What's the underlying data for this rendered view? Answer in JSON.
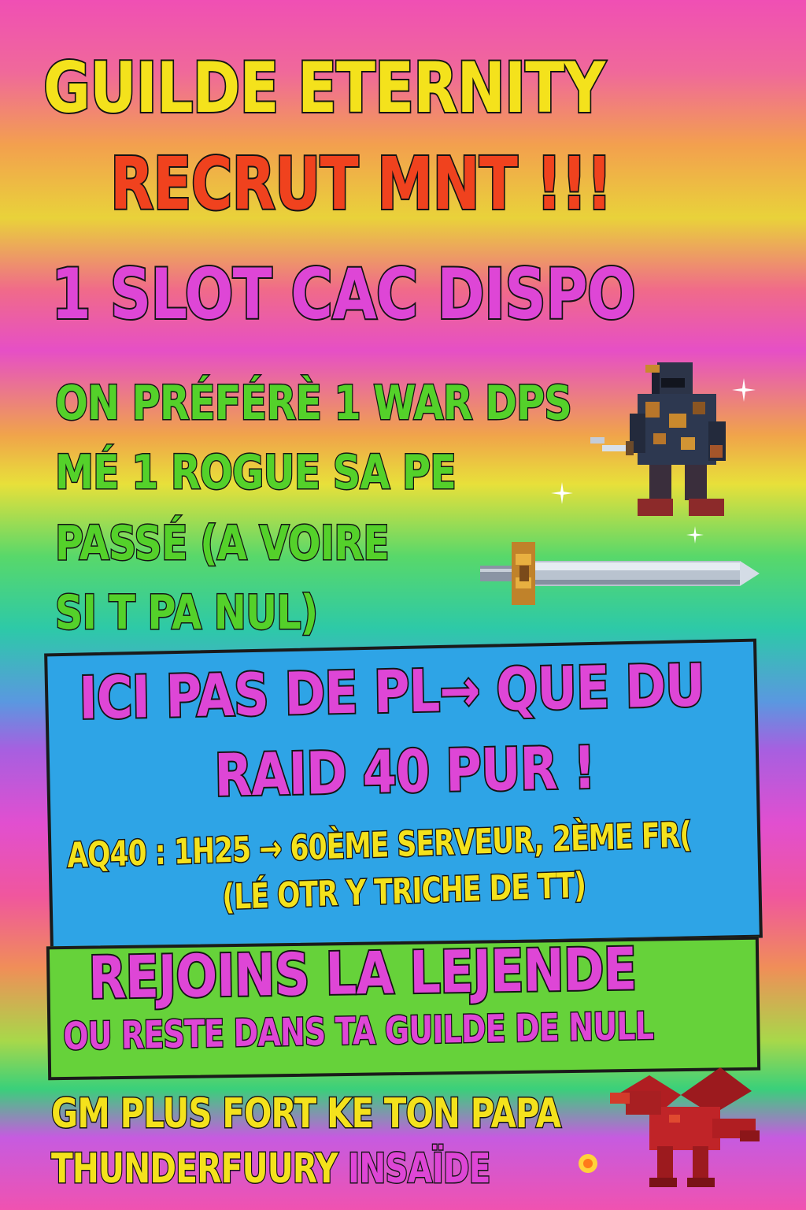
{
  "header": {
    "title": "GUILDE ETERNITY",
    "subtitle": "RECRUT MNT !!!",
    "slot": "1 SLOT CAC DISPO"
  },
  "preference": {
    "lines": [
      "ON PRÉFÉRÈ 1 WAR DPS",
      "MÉ 1 ROGUE SA PE",
      "PASSÉ (A VOIRE",
      "SI T PA NUL)"
    ]
  },
  "raid_box": {
    "line1": "ICI PAS DE PL→ QUE DU",
    "line2": "RAID 40 PUR !",
    "line3": "AQ40 : 1H25 → 60ÈME SERVEUR, 2ÈME FR(",
    "line4": "(LÉ OTR Y TRICHE DE TT)",
    "bg_color": "#2ea4e6"
  },
  "join_box": {
    "line1": "REJOINS LA LEJENDE",
    "line2": "OU RESTE DANS TA GUILDE  DE NULL",
    "bg_color": "#66d23a"
  },
  "footer": {
    "line1": "GM PLUS FORT KE TON PAPA",
    "line2_a": "THUNDERFUURY",
    "line2_b": " INSAÏDE"
  },
  "colors": {
    "yellow": "#f4e21c",
    "red": "#f0421e",
    "pink": "#de46d6",
    "green": "#54d12a"
  },
  "icons": [
    "rogue-sprite-icon",
    "sword-icon",
    "dragon-icon",
    "sparkle-icon"
  ]
}
